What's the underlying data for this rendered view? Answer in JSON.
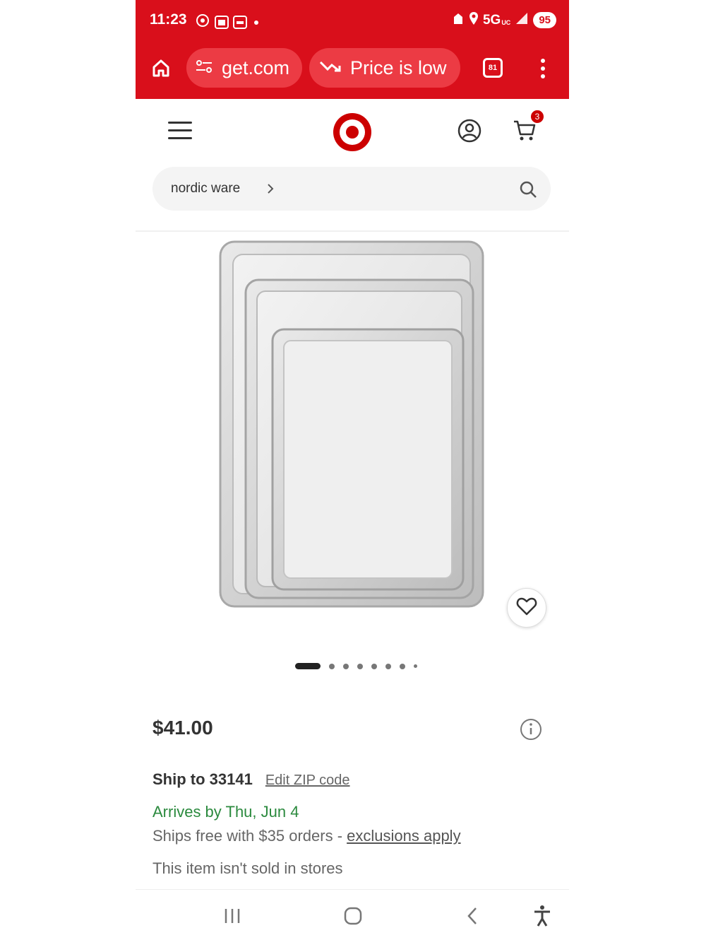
{
  "status_bar": {
    "time": "11:23",
    "network": "5G",
    "network_sub": "UC",
    "battery": "95"
  },
  "browser": {
    "url": "get.com",
    "price_chip": "Price is low",
    "tab_count": "81"
  },
  "header": {
    "cart_count": "3"
  },
  "search": {
    "text": "nordic ware"
  },
  "product": {
    "image": "aluminum-baking-sheet-set",
    "price": "$41.00",
    "carousel_dot_count": 8,
    "carousel_active_index": 0
  },
  "shipping": {
    "ship_to": "Ship to 33141",
    "edit_zip": "Edit ZIP code",
    "arrives": "Arrives by Thu, Jun 4",
    "ships_free_prefix": "Ships free with $35 orders - ",
    "exclusions": "exclusions apply",
    "store_note": "This item isn't sold in stores"
  },
  "colors": {
    "brand_red": "#d90f1b",
    "arrival_green": "#2b8a3e"
  }
}
